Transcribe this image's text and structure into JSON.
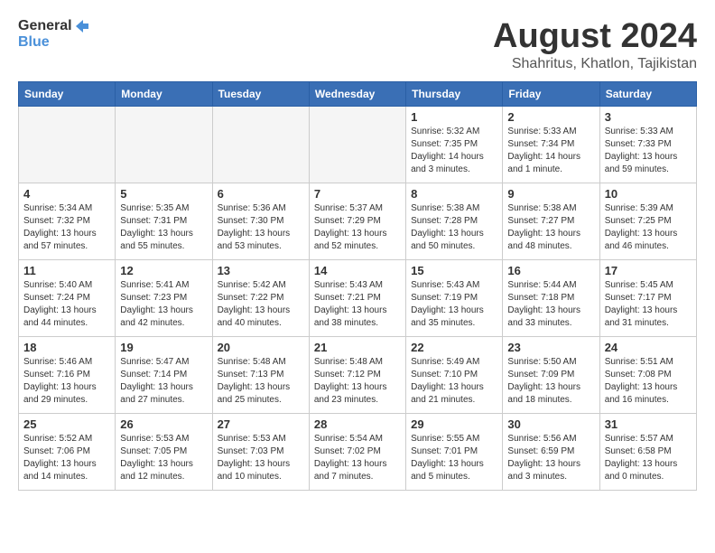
{
  "header": {
    "logo_line1": "General",
    "logo_line2": "Blue",
    "month_year": "August 2024",
    "location": "Shahritus, Khatlon, Tajikistan"
  },
  "weekdays": [
    "Sunday",
    "Monday",
    "Tuesday",
    "Wednesday",
    "Thursday",
    "Friday",
    "Saturday"
  ],
  "weeks": [
    [
      {
        "day": "",
        "info": ""
      },
      {
        "day": "",
        "info": ""
      },
      {
        "day": "",
        "info": ""
      },
      {
        "day": "",
        "info": ""
      },
      {
        "day": "1",
        "info": "Sunrise: 5:32 AM\nSunset: 7:35 PM\nDaylight: 14 hours\nand 3 minutes."
      },
      {
        "day": "2",
        "info": "Sunrise: 5:33 AM\nSunset: 7:34 PM\nDaylight: 14 hours\nand 1 minute."
      },
      {
        "day": "3",
        "info": "Sunrise: 5:33 AM\nSunset: 7:33 PM\nDaylight: 13 hours\nand 59 minutes."
      }
    ],
    [
      {
        "day": "4",
        "info": "Sunrise: 5:34 AM\nSunset: 7:32 PM\nDaylight: 13 hours\nand 57 minutes."
      },
      {
        "day": "5",
        "info": "Sunrise: 5:35 AM\nSunset: 7:31 PM\nDaylight: 13 hours\nand 55 minutes."
      },
      {
        "day": "6",
        "info": "Sunrise: 5:36 AM\nSunset: 7:30 PM\nDaylight: 13 hours\nand 53 minutes."
      },
      {
        "day": "7",
        "info": "Sunrise: 5:37 AM\nSunset: 7:29 PM\nDaylight: 13 hours\nand 52 minutes."
      },
      {
        "day": "8",
        "info": "Sunrise: 5:38 AM\nSunset: 7:28 PM\nDaylight: 13 hours\nand 50 minutes."
      },
      {
        "day": "9",
        "info": "Sunrise: 5:38 AM\nSunset: 7:27 PM\nDaylight: 13 hours\nand 48 minutes."
      },
      {
        "day": "10",
        "info": "Sunrise: 5:39 AM\nSunset: 7:25 PM\nDaylight: 13 hours\nand 46 minutes."
      }
    ],
    [
      {
        "day": "11",
        "info": "Sunrise: 5:40 AM\nSunset: 7:24 PM\nDaylight: 13 hours\nand 44 minutes."
      },
      {
        "day": "12",
        "info": "Sunrise: 5:41 AM\nSunset: 7:23 PM\nDaylight: 13 hours\nand 42 minutes."
      },
      {
        "day": "13",
        "info": "Sunrise: 5:42 AM\nSunset: 7:22 PM\nDaylight: 13 hours\nand 40 minutes."
      },
      {
        "day": "14",
        "info": "Sunrise: 5:43 AM\nSunset: 7:21 PM\nDaylight: 13 hours\nand 38 minutes."
      },
      {
        "day": "15",
        "info": "Sunrise: 5:43 AM\nSunset: 7:19 PM\nDaylight: 13 hours\nand 35 minutes."
      },
      {
        "day": "16",
        "info": "Sunrise: 5:44 AM\nSunset: 7:18 PM\nDaylight: 13 hours\nand 33 minutes."
      },
      {
        "day": "17",
        "info": "Sunrise: 5:45 AM\nSunset: 7:17 PM\nDaylight: 13 hours\nand 31 minutes."
      }
    ],
    [
      {
        "day": "18",
        "info": "Sunrise: 5:46 AM\nSunset: 7:16 PM\nDaylight: 13 hours\nand 29 minutes."
      },
      {
        "day": "19",
        "info": "Sunrise: 5:47 AM\nSunset: 7:14 PM\nDaylight: 13 hours\nand 27 minutes."
      },
      {
        "day": "20",
        "info": "Sunrise: 5:48 AM\nSunset: 7:13 PM\nDaylight: 13 hours\nand 25 minutes."
      },
      {
        "day": "21",
        "info": "Sunrise: 5:48 AM\nSunset: 7:12 PM\nDaylight: 13 hours\nand 23 minutes."
      },
      {
        "day": "22",
        "info": "Sunrise: 5:49 AM\nSunset: 7:10 PM\nDaylight: 13 hours\nand 21 minutes."
      },
      {
        "day": "23",
        "info": "Sunrise: 5:50 AM\nSunset: 7:09 PM\nDaylight: 13 hours\nand 18 minutes."
      },
      {
        "day": "24",
        "info": "Sunrise: 5:51 AM\nSunset: 7:08 PM\nDaylight: 13 hours\nand 16 minutes."
      }
    ],
    [
      {
        "day": "25",
        "info": "Sunrise: 5:52 AM\nSunset: 7:06 PM\nDaylight: 13 hours\nand 14 minutes."
      },
      {
        "day": "26",
        "info": "Sunrise: 5:53 AM\nSunset: 7:05 PM\nDaylight: 13 hours\nand 12 minutes."
      },
      {
        "day": "27",
        "info": "Sunrise: 5:53 AM\nSunset: 7:03 PM\nDaylight: 13 hours\nand 10 minutes."
      },
      {
        "day": "28",
        "info": "Sunrise: 5:54 AM\nSunset: 7:02 PM\nDaylight: 13 hours\nand 7 minutes."
      },
      {
        "day": "29",
        "info": "Sunrise: 5:55 AM\nSunset: 7:01 PM\nDaylight: 13 hours\nand 5 minutes."
      },
      {
        "day": "30",
        "info": "Sunrise: 5:56 AM\nSunset: 6:59 PM\nDaylight: 13 hours\nand 3 minutes."
      },
      {
        "day": "31",
        "info": "Sunrise: 5:57 AM\nSunset: 6:58 PM\nDaylight: 13 hours\nand 0 minutes."
      }
    ]
  ]
}
